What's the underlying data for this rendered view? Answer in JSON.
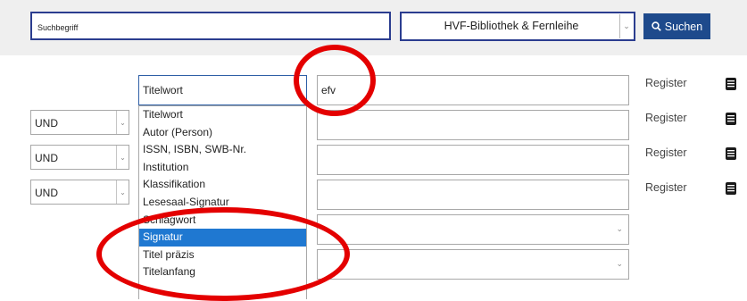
{
  "search": {
    "placeholder": "Suchbegriff",
    "library": "HVF-Bibliothek & Fernleihe",
    "button_label": "Suchen"
  },
  "form": {
    "field_select": "Titelwort",
    "row1_value": "efv",
    "operators": [
      "UND",
      "UND",
      "UND"
    ],
    "register_label": "Register"
  },
  "dropdown": {
    "options": [
      "Titelwort",
      "Autor (Person)",
      "ISSN, ISBN, SWB-Nr.",
      "Institution",
      "Klassifikation",
      "Lesesaal-Signatur",
      "Schlagwort",
      "Signatur",
      "Titel präzis",
      "Titelanfang"
    ],
    "selected": "Signatur"
  },
  "colors": {
    "accent": "#1e4a8c",
    "selection": "#1f78d1",
    "annotation": "#e40000"
  }
}
